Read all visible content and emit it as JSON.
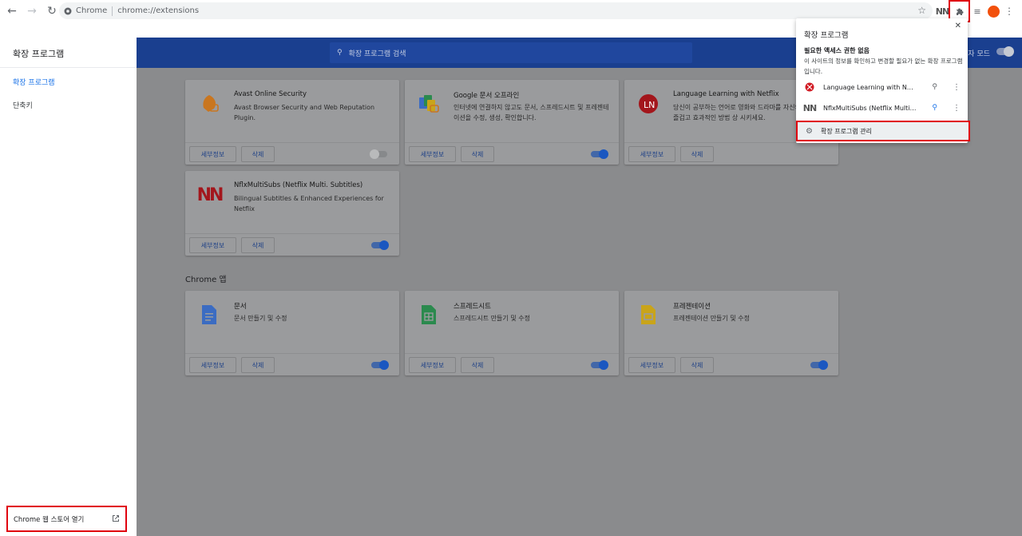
{
  "toolbar": {
    "site_label": "Chrome",
    "url": "chrome://extensions"
  },
  "sidebar": {
    "title": "확장 프로그램",
    "items": [
      {
        "label": "확장 프로그램",
        "active": true
      },
      {
        "label": "단축키",
        "active": false
      }
    ],
    "webstore_label": "Chrome 웹 스토어 열기"
  },
  "header": {
    "search_placeholder": "확장 프로그램 검색",
    "dev_mode_label": "자 모드"
  },
  "extensions": [
    {
      "name": "Avast Online Security",
      "desc": "Avast Browser Security and Web Reputation Plugin.",
      "enabled": false,
      "icon": "avast-icon"
    },
    {
      "name": "Google 문서 오프라인",
      "desc": "인터넷에 연결하지 않고도 문서, 스프레드시트 및 프레젠테이션을 수정, 생성, 확인합니다.",
      "enabled": true,
      "icon": "google-docs-offline-icon"
    },
    {
      "name": "Language Learning with Netflix",
      "desc": "당신이 공부하는 언어로 영화와 드라마를 자신의 언어실력을 즐겁고 효과적인 방법 상 시키세요.",
      "enabled": true,
      "icon": "language-learning-icon"
    },
    {
      "name": "NflxMultiSubs (Netflix Multi. Subtitles)",
      "desc": "Bilingual Subtitles & Enhanced Experiences for Netflix",
      "enabled": true,
      "icon": "nflxmultisubs-icon"
    }
  ],
  "apps_section_title": "Chrome 앱",
  "apps": [
    {
      "name": "문서",
      "desc": "문서 만들기 및 수정",
      "enabled": true,
      "icon": "docs-icon",
      "color": "#4285f4"
    },
    {
      "name": "스프레드시트",
      "desc": "스프레드시트 만들기 및 수정",
      "enabled": true,
      "icon": "sheets-icon",
      "color": "#0f9d58"
    },
    {
      "name": "프레젠테이션",
      "desc": "프레젠테이션 만들기 및 수정",
      "enabled": true,
      "icon": "slides-icon",
      "color": "#f4b400"
    }
  ],
  "buttons": {
    "details": "세부정보",
    "remove": "삭제"
  },
  "popup": {
    "title": "확장 프로그램",
    "subtitle": "필요한 액세스 권한 없음",
    "desc": "이 사이트의 정보를 확인하고 변경할 필요가 없는 확장 프로그램입니다.",
    "items": [
      {
        "name": "Language Learning with Netflix",
        "pinned": false
      },
      {
        "name": "NflxMultiSubs (Netflix Multi. S...",
        "pinned": true
      }
    ],
    "manage_label": "확장 프로그램 관리"
  },
  "colors": {
    "accent": "#1a73e8",
    "highlight": "#e0000f",
    "avatar": "#f2500c"
  }
}
